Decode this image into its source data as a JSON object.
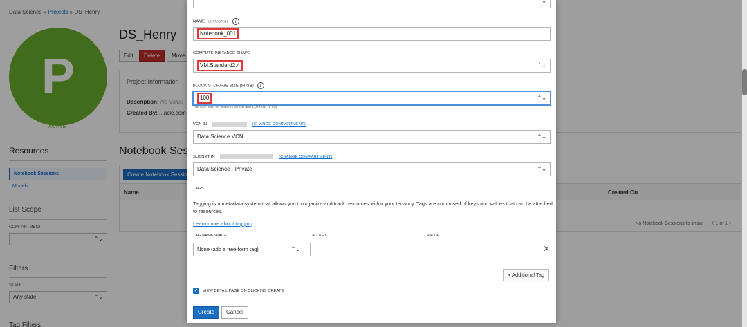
{
  "breadcrumb": {
    "root": "Data Science",
    "sep1": "»",
    "projects": "Projects",
    "sep2": "»",
    "current": "DS_Henry"
  },
  "project": {
    "avatar_letter": "P",
    "status": "ACTIVE",
    "title": "DS_Henry",
    "edit_label": "Edit",
    "delete_label": "Delete",
    "move_label": "Move R",
    "info_header": "Project Information",
    "description_label": "Description:",
    "description_value": "No Value",
    "created_by_label": "Created By:",
    "created_by_value": "...acle.com"
  },
  "resources": {
    "title": "Resources",
    "active_item": "Notebook Sessions",
    "item2": "Models"
  },
  "notebooks": {
    "title": "Notebook Sess",
    "create_label": "Create Notebook Sessio",
    "col_name": "Name",
    "col_created": "Created On",
    "empty_text": "No Notebook Sessions to show",
    "pager": "〈 1 of 1 〉"
  },
  "list_scope": {
    "title": "List Scope",
    "compartment_label": "COMPARTMENT"
  },
  "filters": {
    "title": "Filters",
    "state_label": "STATE",
    "state_value": "Any state",
    "tag_filters": "Tag Filters"
  },
  "modal": {
    "name_label": "NAME",
    "name_optional": "OPTIONAL",
    "name_value": "Notebook_001",
    "shape_label": "COMPUTE INSTANCE SHAPE",
    "shape_value": "VM.Standard2.4",
    "storage_label": "BLOCK STORAGE SIZE (IN GB)",
    "storage_value": "100",
    "storage_hint": "The size must be between 50 GB and 1,024 GB (1 TB)",
    "vcn_label": "VCN IN",
    "vcn_change": "(CHANGE COMPARTMENT)",
    "vcn_value": "Data Science VCN",
    "subnet_label": "SUBNET IN",
    "subnet_change": "(CHANGE COMPARTMENT)",
    "subnet_value": "Data Science - Private",
    "tags_label": "TAGS",
    "tags_text": "Tagging is a metadata system that allows you to organize and track resources within your tenancy. Tags are composed of keys and values that can be attached to resources.",
    "learn_more": "Learn more about tagging",
    "tag_namespace_label": "TAG NAMESPACE",
    "tag_namespace_value": "None (add a free-form tag)",
    "tag_key_label": "TAG KEY",
    "tag_value_label": "VALUE",
    "add_tag_label": "+ Additional Tag",
    "view_detail_label": "VIEW DETAIL PAGE ON CLICKING CREATE",
    "create_label": "Create",
    "cancel_label": "Cancel"
  },
  "icons": {
    "chevron": "⌃⌄",
    "info": "i",
    "close": "✕",
    "check": "✓"
  }
}
